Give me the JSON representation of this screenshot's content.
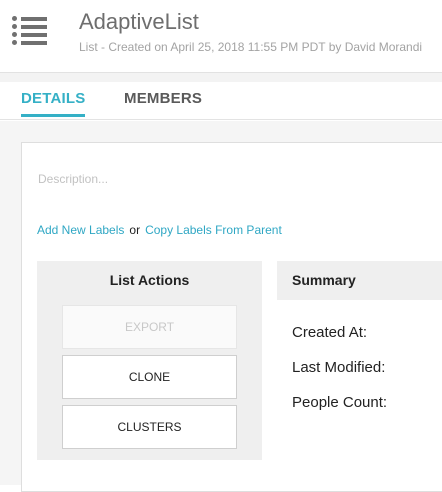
{
  "header": {
    "icon": "list-icon",
    "title": "AdaptiveList",
    "subtitle": "List - Created on April 25, 2018 11:55 PM PDT by David Morandi"
  },
  "tabs": [
    {
      "label": "DETAILS",
      "active": true
    },
    {
      "label": "MEMBERS",
      "active": false
    }
  ],
  "colors": {
    "accent": "#35b0c6",
    "link": "#2fa7c4",
    "panel_bg": "#efefef"
  },
  "description": {
    "placeholder": "Description..."
  },
  "labels": {
    "add_new": "Add New Labels",
    "separator": "or",
    "copy_from_parent": "Copy Labels From Parent"
  },
  "list_actions": {
    "title": "List Actions",
    "buttons": [
      {
        "label": "EXPORT",
        "disabled": true
      },
      {
        "label": "CLONE",
        "disabled": false
      },
      {
        "label": "CLUSTERS",
        "disabled": false
      }
    ]
  },
  "summary": {
    "title": "Summary",
    "fields": [
      {
        "label": "Created At:"
      },
      {
        "label": "Last Modified:"
      },
      {
        "label": "People Count:"
      }
    ]
  }
}
